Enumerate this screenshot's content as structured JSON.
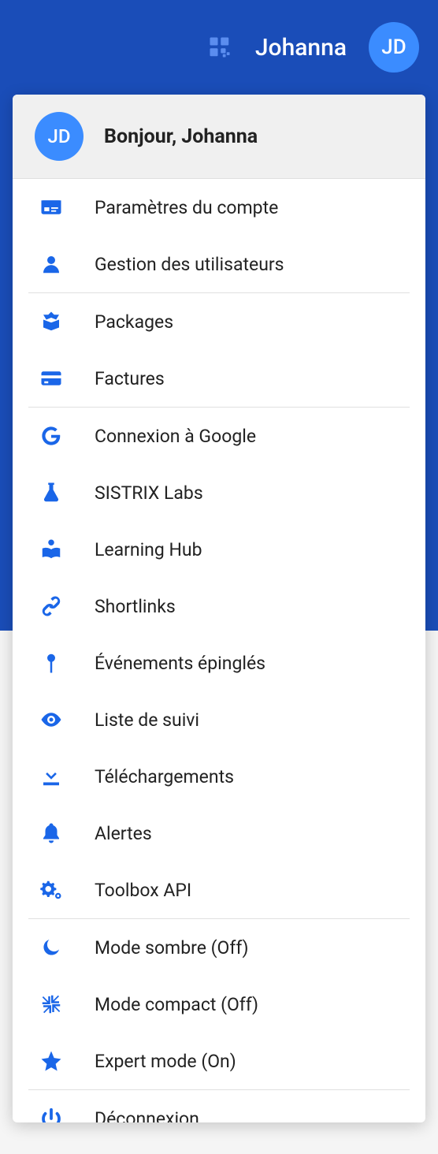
{
  "header": {
    "user_name": "Johanna",
    "avatar_initials": "JD"
  },
  "dropdown": {
    "avatar_initials": "JD",
    "greeting": "Bonjour, Johanna",
    "groups": [
      [
        {
          "icon": "id-card-icon",
          "label": "Paramètres du compte"
        },
        {
          "icon": "user-icon",
          "label": "Gestion des utilisateurs"
        }
      ],
      [
        {
          "icon": "box-open-icon",
          "label": "Packages"
        },
        {
          "icon": "credit-card-icon",
          "label": "Factures"
        }
      ],
      [
        {
          "icon": "google-icon",
          "label": "Connexion à Google"
        },
        {
          "icon": "flask-icon",
          "label": "SISTRIX Labs"
        },
        {
          "icon": "book-reader-icon",
          "label": "Learning Hub"
        },
        {
          "icon": "link-icon",
          "label": "Shortlinks"
        },
        {
          "icon": "pin-icon",
          "label": "Événements épinglés"
        },
        {
          "icon": "eye-icon",
          "label": "Liste de suivi"
        },
        {
          "icon": "download-icon",
          "label": "Téléchargements"
        },
        {
          "icon": "bell-icon",
          "label": "Alertes"
        },
        {
          "icon": "cogs-icon",
          "label": "Toolbox API"
        }
      ],
      [
        {
          "icon": "moon-icon",
          "label": "Mode sombre (Off)"
        },
        {
          "icon": "compress-icon",
          "label": "Mode compact (Off)"
        },
        {
          "icon": "star-icon",
          "label": "Expert mode (On)"
        }
      ],
      [
        {
          "icon": "power-icon",
          "label": "Déconnexion"
        }
      ]
    ]
  }
}
